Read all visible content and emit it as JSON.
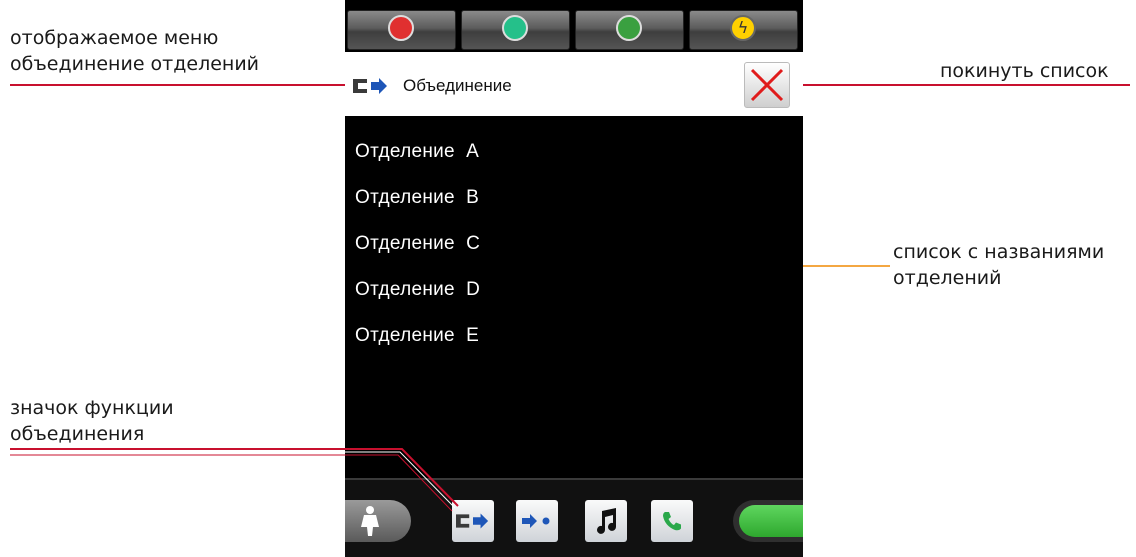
{
  "annotations": {
    "menu_line1": "отображаемое меню",
    "menu_line2": "объединение отделений",
    "leave_list": "покинуть список",
    "list_names_line1": "список с названиями",
    "list_names_line2": "отделений",
    "icon_line1": "значок функции",
    "icon_line2": "объединения"
  },
  "header": {
    "title": "Объединение",
    "icon": "merge-icon",
    "close_icon": "close-icon"
  },
  "top_buttons": [
    {
      "icon": "red-circle-icon",
      "color": "#e03030"
    },
    {
      "icon": "green-circle-icon",
      "color": "#25c08a"
    },
    {
      "icon": "green-target-icon",
      "color": "#3aa040"
    },
    {
      "icon": "lightning-icon",
      "color": "#ffd000"
    }
  ],
  "departments": [
    {
      "name": "Отделение",
      "letter": "A"
    },
    {
      "name": "Отделение",
      "letter": "B"
    },
    {
      "name": "Отделение",
      "letter": "C"
    },
    {
      "name": "Отделение",
      "letter": "D"
    },
    {
      "name": "Отделение",
      "letter": "E"
    }
  ],
  "toolbar": {
    "icons": [
      "person-icon",
      "merge-icon",
      "forward-dot-icon",
      "music-note-icon",
      "phone-icon",
      "green-toggle-icon"
    ]
  },
  "colors": {
    "annotation_red": "#c8102e",
    "annotation_orange": "#f4a742",
    "icon_blue": "#1e56b8"
  }
}
